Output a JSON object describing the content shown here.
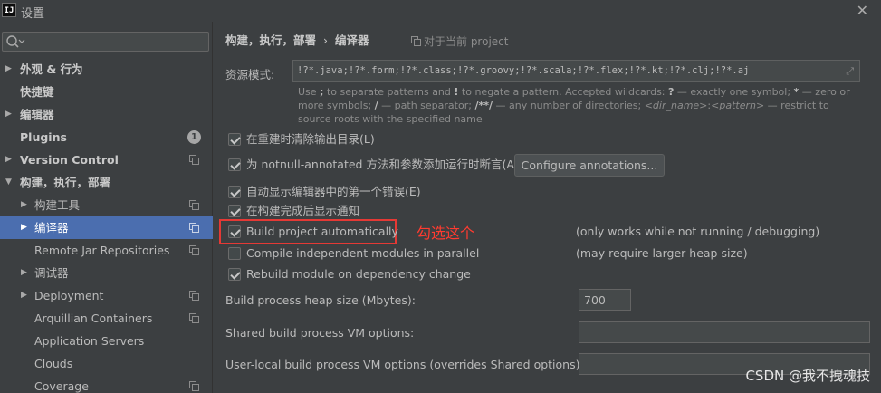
{
  "window": {
    "logo": "IJ",
    "title": "设置"
  },
  "search": {
    "placeholder": "",
    "value": ""
  },
  "sidebar": {
    "items": [
      {
        "label": "外观 & 行为",
        "bold": true
      },
      {
        "label": "快捷键",
        "bold": true
      },
      {
        "label": "编辑器",
        "bold": true
      },
      {
        "label": "Plugins",
        "bold": true,
        "badge": "1"
      },
      {
        "label": "Version Control",
        "bold": true
      },
      {
        "label": "构建，执行，部署",
        "bold": true
      },
      {
        "label": "构建工具"
      },
      {
        "label": "编译器"
      },
      {
        "label": "Remote Jar Repositories"
      },
      {
        "label": "调试器"
      },
      {
        "label": "Deployment"
      },
      {
        "label": "Arquillian Containers"
      },
      {
        "label": "Application Servers"
      },
      {
        "label": "Clouds"
      },
      {
        "label": "Coverage"
      }
    ]
  },
  "breadcrumb": {
    "parent": "构建，执行，部署",
    "separator": "›",
    "current": "编译器"
  },
  "scope_label": "对于当前 project",
  "resource": {
    "label": "资源模式:",
    "value": "!?*.java;!?*.form;!?*.class;!?*.groovy;!?*.scala;!?*.flex;!?*.kt;!?*.clj;!?*.aj",
    "hint": {
      "p1": "Use ",
      "b1": ";",
      "p2": " to separate patterns and ",
      "b2": "!",
      "p3": " to negate a pattern. Accepted wildcards: ",
      "b3": "?",
      "p4": " — exactly one symbol; ",
      "b4": "*",
      "p5": " — zero or more symbols; ",
      "b5": "/",
      "p6": " — path separator; ",
      "b6": "/**/",
      "p7": " — any number of directories; ",
      "i1": "<dir_name>",
      "p8": ":",
      "i2": "<pattern>",
      "p9": " — restrict to source roots with the specified name"
    }
  },
  "options": {
    "clear_output": {
      "label": "在重建时清除输出目录(L)",
      "checked": true
    },
    "notnull": {
      "label": "为 notnull-annotated 方法和参数添加运行时断言(A)",
      "checked": true
    },
    "configure_annotations": "Configure annotations...",
    "auto_show_error": {
      "label": "自动显示编辑器中的第一个错误(E)",
      "checked": true
    },
    "notify_build": {
      "label": "在构建完成后显示通知",
      "checked": true
    },
    "build_auto": {
      "label": "Build project automatically",
      "checked": true,
      "note": "(only works while not running / debugging)"
    },
    "compile_parallel": {
      "label": "Compile independent modules in parallel",
      "checked": false,
      "note": "(may require larger heap size)"
    },
    "rebuild_dep": {
      "label": "Rebuild module on dependency change",
      "checked": true
    }
  },
  "fields": {
    "heap_size": {
      "label": "Build process heap size (Mbytes):",
      "value": "700"
    },
    "shared_vm": {
      "label": "Shared build process VM options:",
      "value": ""
    },
    "user_vm": {
      "label": "User-local build process VM options (overrides Shared options):",
      "value": ""
    }
  },
  "annotation": {
    "text": "勾选这个",
    "color": "#ff3b30"
  },
  "watermark": "CSDN @我不拽魂技",
  "colors": {
    "background": "#3c3f41",
    "selection": "#4b6eaf",
    "highlight": "#e53935"
  }
}
